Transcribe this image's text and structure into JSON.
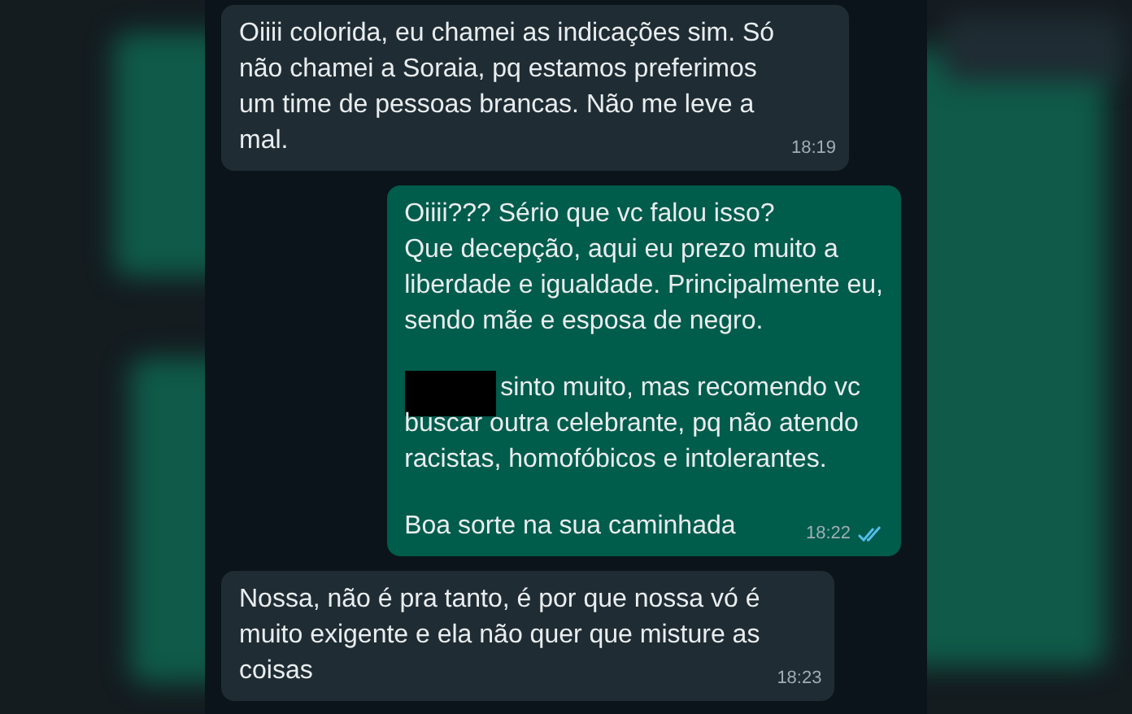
{
  "messages": [
    {
      "kind": "incoming",
      "paragraphs": [
        {
          "redacted_prefix": false,
          "text": "Oiiii colorida, eu chamei as indicações sim. Só\nnão chamei a Soraia, pq estamos preferimos\num time de pessoas brancas. Não me leve a\nmal."
        }
      ],
      "time": "18:19"
    },
    {
      "kind": "outgoing",
      "paragraphs": [
        {
          "redacted_prefix": false,
          "text": "Oiiii??? Sério que vc falou isso?\nQue decepção, aqui eu prezo muito a\nliberdade e igualdade. Principalmente eu,\nsendo mãe e esposa de negro."
        },
        {
          "redacted_prefix": true,
          "text": "sinto muito, mas recomendo vc\nbuscar outra celebrante, pq não atendo\nracistas, homofóbicos e intolerantes."
        },
        {
          "redacted_prefix": false,
          "text": "Boa sorte na sua caminhada"
        }
      ],
      "time": "18:22",
      "read": true
    },
    {
      "kind": "incoming",
      "paragraphs": [
        {
          "redacted_prefix": false,
          "text": "Nossa, não é pra tanto, é por que nossa vó é\nmuito exigente e ela não quer que misture as\ncoisas"
        }
      ],
      "time": "18:23"
    }
  ]
}
